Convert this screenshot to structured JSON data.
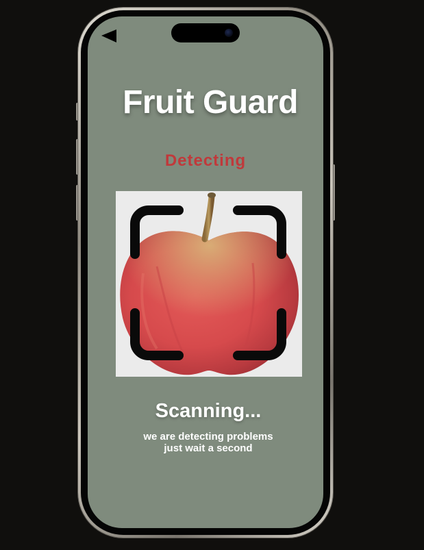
{
  "app": {
    "title": "Fruit Guard"
  },
  "status": {
    "label": "Detecting",
    "color": "#c0393b"
  },
  "scan": {
    "title": "Scanning...",
    "line1": "we are detecting problems",
    "line2": "just wait a second",
    "subject_icon": "apple-image",
    "frame_icon": "scan-frame-icon"
  },
  "nav": {
    "back_icon": "back-arrow-icon"
  },
  "colors": {
    "background": "#100f0d",
    "screen": "#7f8b7d",
    "text": "#ffffff",
    "scan_frame": "#0a0a0a"
  }
}
